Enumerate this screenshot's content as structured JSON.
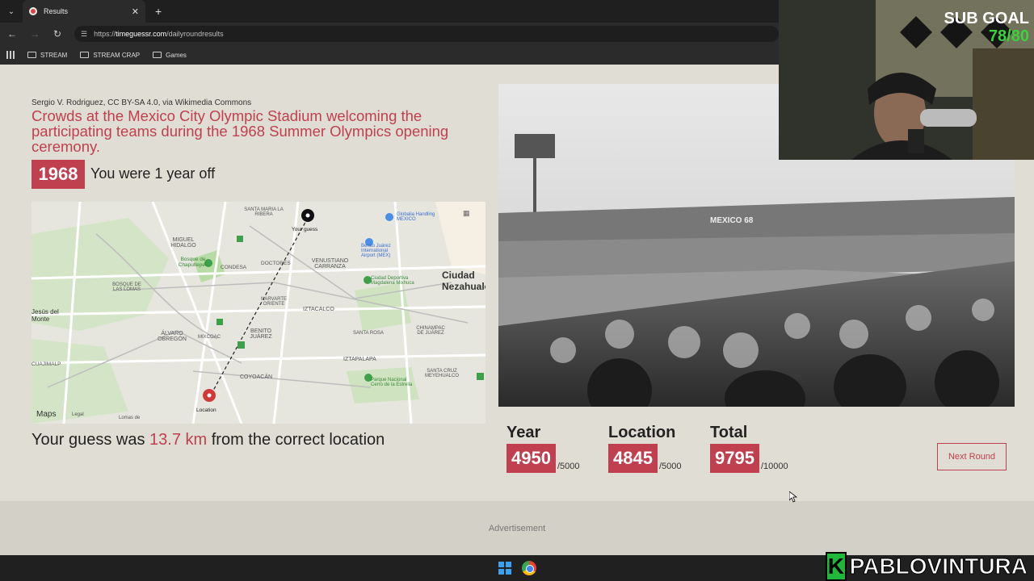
{
  "browser": {
    "tab_title": "Results",
    "tab_close": "✕",
    "new_tab": "+",
    "url_scheme": "https://",
    "url_host": "timeguessr.com",
    "url_path": "/dailyroundresults",
    "bookmarks": [
      "STREAM",
      "STREAM CRAP",
      "Games"
    ]
  },
  "result": {
    "credit": "Sergio V. Rodriguez, CC BY-SA 4.0, via Wikimedia Commons",
    "caption": "Crowds at the Mexico City Olympic Stadium welcoming the participating teams during the 1968 Summer Olympics opening ceremony.",
    "year": "1968",
    "year_off_text": "You were 1 year off",
    "guess_prefix": "Your guess was ",
    "guess_distance": "13.7 km",
    "guess_suffix": " from the correct location"
  },
  "map": {
    "guess_label": "Your guess",
    "location_label": "Location",
    "maps_logo": "Maps",
    "legal": "Legal",
    "labels": [
      "SANTA MARIA LA RIBERA",
      "MIGUEL HIDALGO",
      "CONDESA",
      "DOCTORES",
      "VENUSTIANO CARRANZA",
      "Bosque de Chapultepec",
      "BOSQUE DE LAS LOMAS",
      "NARVARTE ORIENTE",
      "IZTACALCO",
      "Jesús del Monte",
      "ÁLVARO OBREGÓN",
      "MIXCOAC",
      "BENITO JUÁREZ",
      "SANTA ROSA",
      "CHINAMPAC DE JUÁREZ",
      "IZTAPALAPA",
      "COYOACÁN",
      "SANTA CRUZ MEYEHUALCO",
      "CUAJIMALPA",
      "Ciudad Nezahualcóyotl",
      "Benito Juárez International Airport (MEX)",
      "Ciudad Deportiva Magdalena Mixhuca",
      "Parque Nacional Cerro de la Estrella",
      "Globalia Handling MEXICO",
      "Lomas de"
    ]
  },
  "photo": {
    "scoreboard_text": "MEXICO 68"
  },
  "scores": {
    "year": {
      "label": "Year",
      "value": "4950",
      "max": "/5000"
    },
    "location": {
      "label": "Location",
      "value": "4845",
      "max": "/5000"
    },
    "total": {
      "label": "Total",
      "value": "9795",
      "max": "/10000"
    }
  },
  "next_round_label": "Next Round",
  "advertisement_label": "Advertisement",
  "overlay": {
    "sub_goal_title": "SUB GOAL",
    "sub_goal_value": "78/80",
    "brand_letter": "K",
    "brand_name": "PABLOVINTURA"
  },
  "colors": {
    "accent": "#c0404f",
    "page_bg": "#e0ddd4",
    "sub_goal_green": "#3bd23b"
  }
}
